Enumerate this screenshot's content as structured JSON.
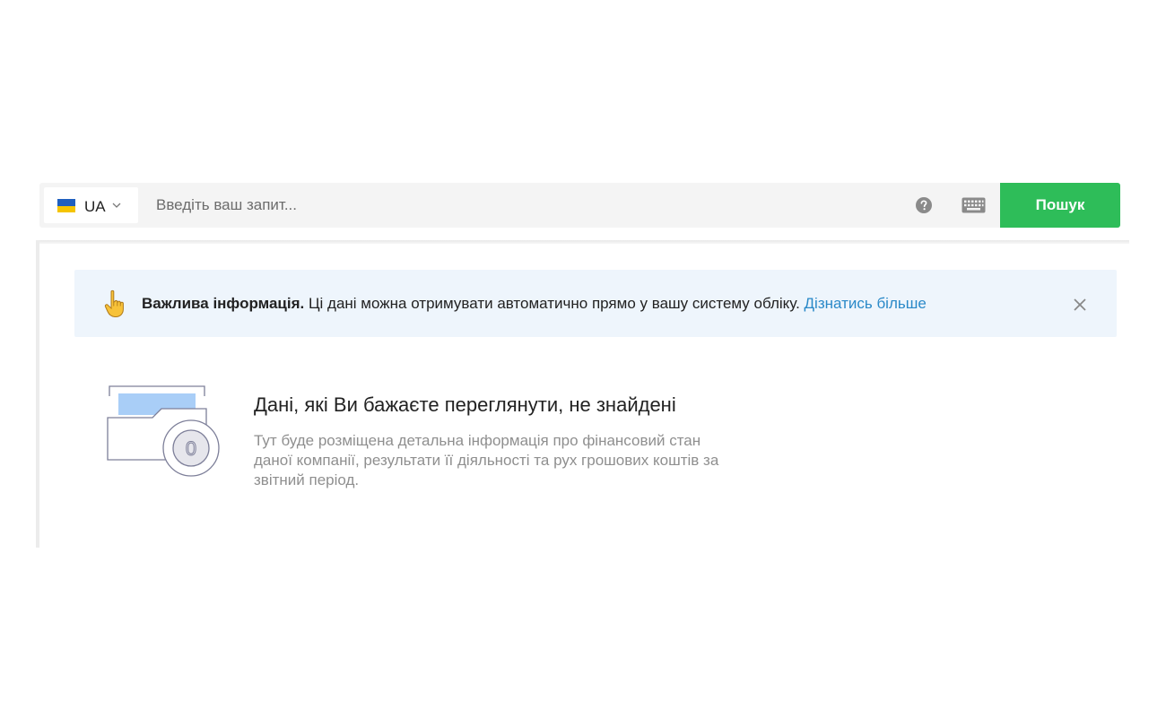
{
  "search": {
    "language": {
      "code": "UA",
      "flag_colors": [
        "#1f5fbf",
        "#f5c400"
      ]
    },
    "placeholder": "Введіть ваш запит...",
    "value": "",
    "help_icon": "question-circle-icon",
    "keyboard_icon": "keyboard-icon",
    "button_label": "Пошук",
    "button_color": "#2ebd59"
  },
  "banner": {
    "icon": "pointing-up-hand-icon",
    "bold_text": "Важлива інформація.",
    "text": " Ці дані можна отримувати автоматично прямо у вашу систему обліку. ",
    "link_text": "Дізнатись більше",
    "link_color": "#2a89c8",
    "background": "#eef5fc",
    "close_icon": "close-icon"
  },
  "empty_state": {
    "illustration": "empty-folder-coin-icon",
    "coin_label": "0",
    "title": "Дані, які Ви бажаєте переглянути, не знайдені",
    "description": "Тут буде розміщена детальна інформація про фінансовий стан даної компанії, результати її діяльності та рух грошових коштів за звітний період."
  }
}
